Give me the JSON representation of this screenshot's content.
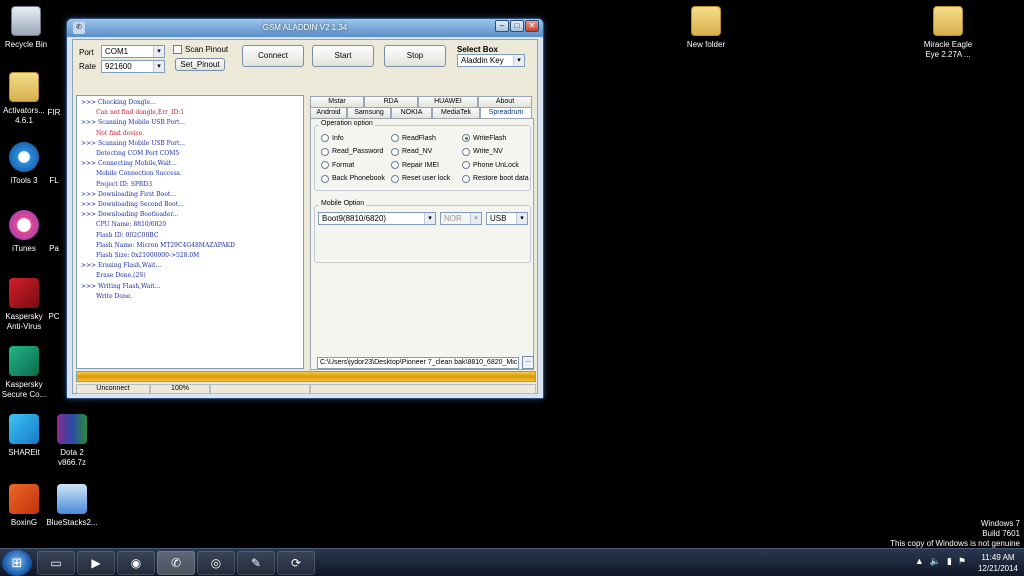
{
  "desktop": {
    "icons_left": [
      {
        "label": "Recycle Bin",
        "icon": "recycle-bin-icon"
      },
      {
        "label": "Activators...\n4.6.1",
        "icon": "folder-icon"
      },
      {
        "label": "iTools 3",
        "icon": "itools-icon"
      },
      {
        "label": "iTunes",
        "icon": "itunes-icon"
      },
      {
        "label": "Kaspersky\nAnti-Virus",
        "icon": "kaspersky-icon"
      },
      {
        "label": "Kaspersky\nSecure Co...",
        "icon": "kaspersky-secure-icon"
      },
      {
        "label": "SHAREit",
        "icon": "shareit-icon"
      },
      {
        "label": "BoxinG",
        "icon": "office-icon"
      }
    ],
    "icons_col2": [
      {
        "label": "Dota 2\nv866.7z",
        "icon": "winrar-icon"
      },
      {
        "label": "BlueStacks2...",
        "icon": "bluestacks-icon"
      }
    ],
    "partial_labels": [
      "FIR",
      "FL",
      "Pa",
      "PC"
    ],
    "icons_right": [
      {
        "label": "New folder",
        "icon": "folder-icon"
      },
      {
        "label": "Miracle Eagle\nEye 2.27A ...",
        "icon": "folder-icon"
      }
    ]
  },
  "window": {
    "title": "GSM ALADDIN V2 1.34",
    "port_label": "Port",
    "port_value": "COM1",
    "rate_label": "Rate",
    "rate_value": "921600",
    "scan_pinout_label": "Scan Pinout",
    "set_pinout_label": "Set_Pinout",
    "connect_label": "Connect",
    "start_label": "Start",
    "stop_label": "Stop",
    "select_box_label": "Select Box",
    "select_box_value": "Aladdin Key"
  },
  "log": [
    {
      "text": ">>> Checking Dongle...",
      "color": "blue",
      "indent": false
    },
    {
      "text": "Can not find dongle,Err_ID:1",
      "color": "red",
      "indent": true
    },
    {
      "text": ">>> Scanning Mobile USB Port...",
      "color": "blue",
      "indent": false
    },
    {
      "text": "Not find device.",
      "color": "red",
      "indent": true
    },
    {
      "text": ">>> Scanning Mobile USB Port...",
      "color": "blue",
      "indent": false
    },
    {
      "text": "Detecting COM Port COM5",
      "color": "blue",
      "indent": true
    },
    {
      "text": ">>> Connecting Mobile,Wait...",
      "color": "blue",
      "indent": false
    },
    {
      "text": "Mobile Connection Success.",
      "color": "blue",
      "indent": true
    },
    {
      "text": "Project ID: SPRD3",
      "color": "blue",
      "indent": true
    },
    {
      "text": ">>> Downloading First Boot...",
      "color": "blue",
      "indent": false
    },
    {
      "text": ">>> Downloading Second Boot...",
      "color": "blue",
      "indent": false
    },
    {
      "text": ">>> Downloading Bootloader...",
      "color": "blue",
      "indent": false
    },
    {
      "text": "CPU Name: 8810/6820",
      "color": "blue",
      "indent": true
    },
    {
      "text": "Flash ID: 002C00BC",
      "color": "blue",
      "indent": true
    },
    {
      "text": "Flash Name: Micron MT29C4G48MAZAPAKD",
      "color": "blue",
      "indent": true
    },
    {
      "text": "Flash Size: 0x21000000->528.0M",
      "color": "blue",
      "indent": true
    },
    {
      "text": ">>> Erasing Flash,Wait...",
      "color": "blue",
      "indent": false
    },
    {
      "text": "Erase Done.(2S)",
      "color": "blue",
      "indent": true
    },
    {
      "text": ">>> Writing Flash,Wait...",
      "color": "blue",
      "indent": false
    },
    {
      "text": "Write Done.",
      "color": "blue",
      "indent": true
    }
  ],
  "tabs_top": [
    "Mstar",
    "RDA",
    "HUAWEI",
    "About"
  ],
  "tabs_bottom": [
    "Android",
    "Samsung",
    "NOKIA",
    "MediaTek",
    "Spreadrum"
  ],
  "active_tab": "Spreadrum",
  "operation": {
    "title": "Operation option",
    "col1": [
      "Info",
      "Read_Password",
      "Format",
      "Back Phonebook"
    ],
    "col2": [
      "ReadFlash",
      "Read_NV",
      "Repair IMEI",
      "Reset user lock"
    ],
    "col3": [
      "WriteFlash",
      "Write_NV",
      "Phone UnLock",
      "Restore boot data"
    ],
    "selected": "WriteFlash"
  },
  "mobile_option": {
    "title": "Mobile Option",
    "model": "Boot9(8810/6820)",
    "flash_type": "NOR",
    "connection": "USB"
  },
  "file_path": "C:\\Users\\jydor23\\Desktop\\Pioneer 7_clean bak\\8810_6820_Mic",
  "browse_label": "...",
  "progress_percent": 100,
  "status": {
    "connection": "Unconnect",
    "percent_text": "100%"
  },
  "colors": {
    "progress_fill": "#e0a81c",
    "log_blue": "#1a2fa8",
    "log_red": "#c0182a"
  },
  "taskbar": {
    "items": [
      "folder-icon",
      "media-player-icon",
      "chrome-icon",
      "aladdin-icon",
      "itools-icon",
      "notepad-icon",
      "shareit-icon"
    ],
    "time": "11:49 AM",
    "date": "12/21/2014"
  },
  "watermark": {
    "line1": "Windows 7",
    "line2": "Build 7601",
    "line3": "This copy of Windows is not genuine"
  }
}
